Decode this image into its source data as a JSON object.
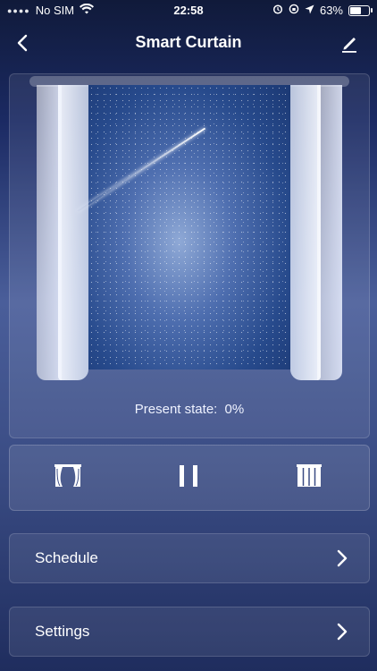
{
  "statusbar": {
    "carrier": "No SIM",
    "time": "22:58",
    "battery": "63%"
  },
  "header": {
    "title": "Smart Curtain"
  },
  "preview": {
    "present_state_label": "Present state:",
    "present_state_value": "0%"
  },
  "controls": {
    "open_icon": "curtain-open-icon",
    "pause_icon": "pause-icon",
    "close_icon": "curtain-close-icon"
  },
  "menu": {
    "schedule": "Schedule",
    "settings": "Settings"
  },
  "colors": {
    "background_top": "#101a3a",
    "background_mid": "#4a5e9a",
    "text": "#ffffff"
  }
}
